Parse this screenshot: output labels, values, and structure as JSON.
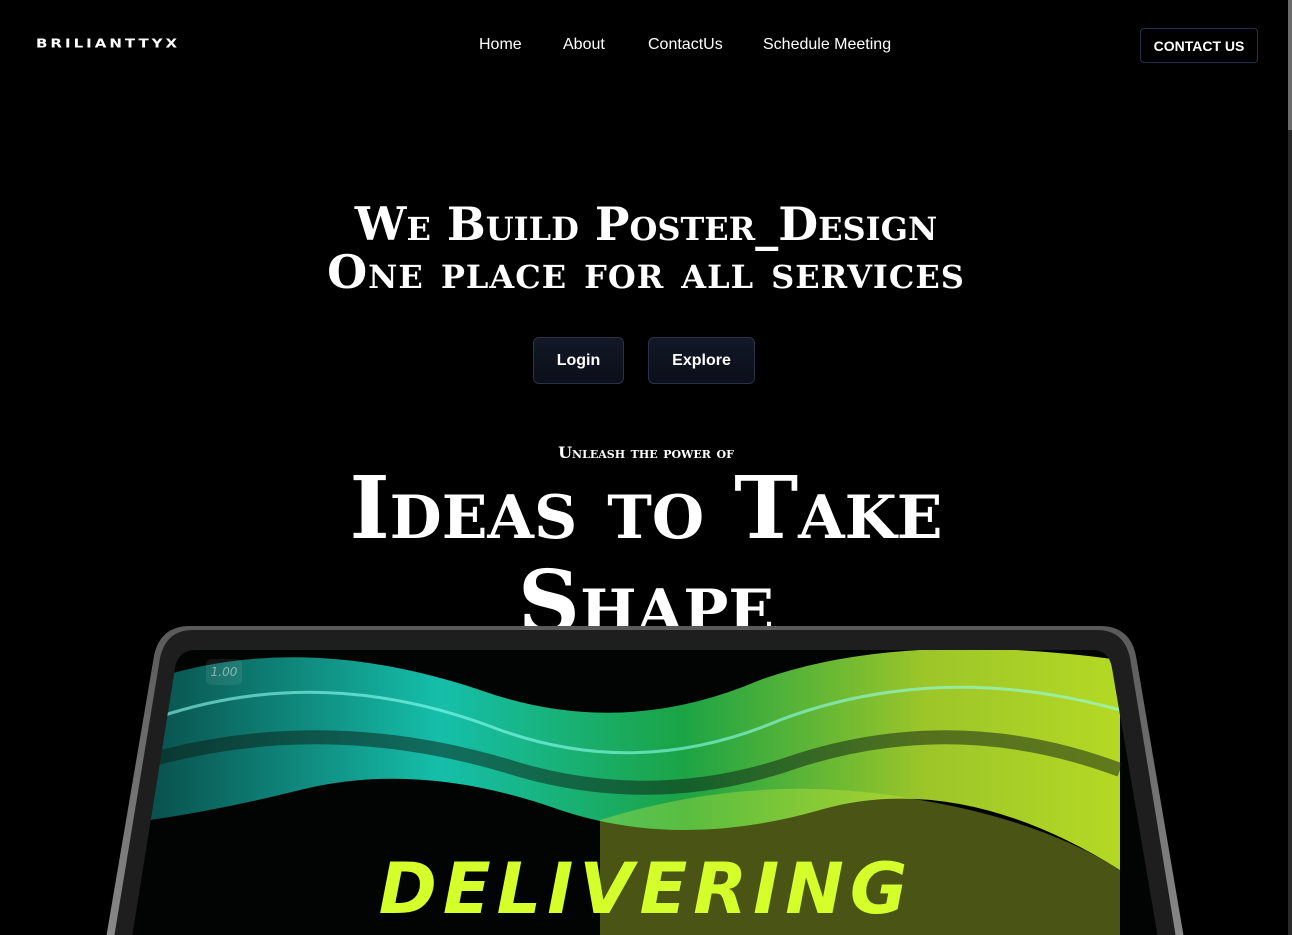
{
  "header": {
    "logo": "BRILIANTTYX",
    "nav": [
      "Home",
      "About",
      "ContactUs",
      "Schedule Meeting"
    ],
    "contact_button": "CONTACT US"
  },
  "hero": {
    "title_line1": "We Build Poster_Design",
    "title_line2": "One place for all services",
    "login_button": "Login",
    "explore_button": "Explore",
    "subtitle": "Unleash the power of",
    "headline_line1": "Ideas to Take",
    "headline_line2": "Shape"
  },
  "laptop_screen": {
    "zoom_badge": "1.00",
    "screen_text": "DELIVERING",
    "accent_colors": [
      "#19e0c8",
      "#20d060",
      "#d4ff2a"
    ]
  }
}
